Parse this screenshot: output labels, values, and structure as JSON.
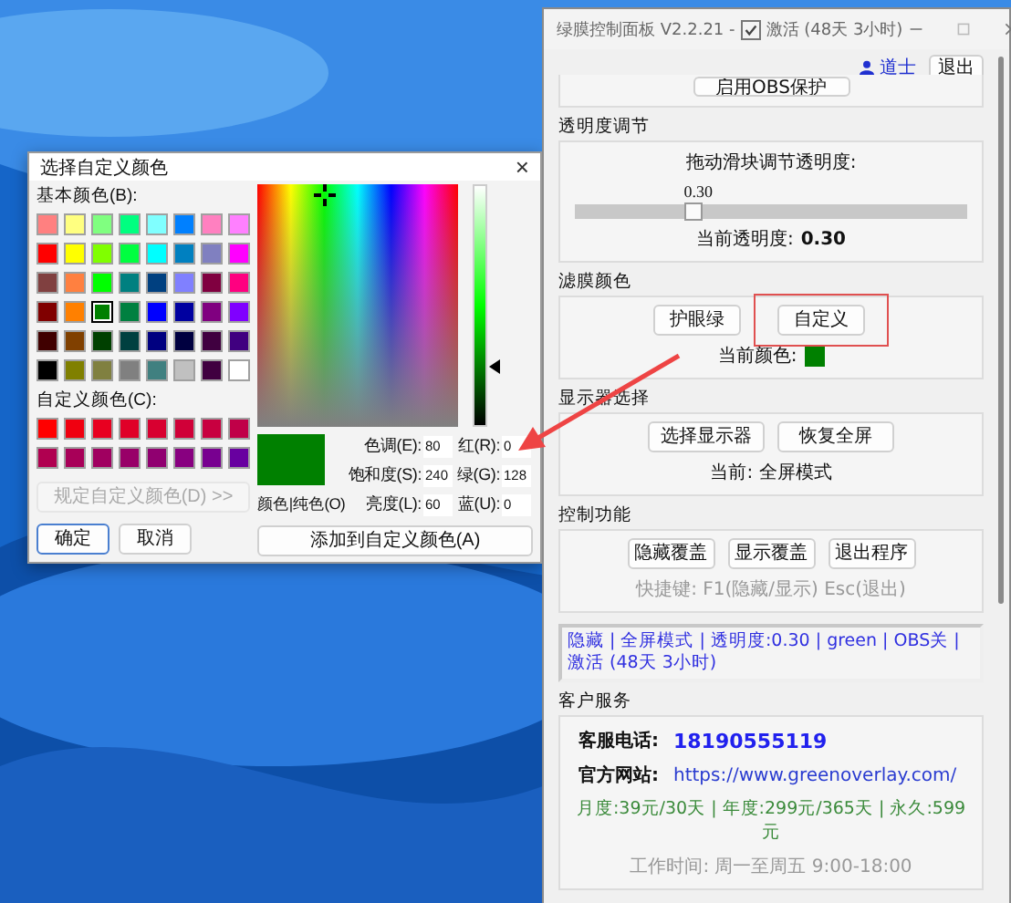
{
  "color_dialog": {
    "title": "选择自定义颜色",
    "close": "×",
    "basic_label": "基本颜色(B):",
    "basic_colors": [
      {
        "color": "#ff8080",
        "selected": false
      },
      {
        "color": "#ffff80",
        "selected": false
      },
      {
        "color": "#80ff80",
        "selected": false
      },
      {
        "color": "#00ff80",
        "selected": false
      },
      {
        "color": "#80ffff",
        "selected": false
      },
      {
        "color": "#0080ff",
        "selected": false
      },
      {
        "color": "#ff80c0",
        "selected": false
      },
      {
        "color": "#ff80ff",
        "selected": false
      },
      {
        "color": "#ff0000",
        "selected": false
      },
      {
        "color": "#ffff00",
        "selected": false
      },
      {
        "color": "#80ff00",
        "selected": false
      },
      {
        "color": "#00ff40",
        "selected": false
      },
      {
        "color": "#00ffff",
        "selected": false
      },
      {
        "color": "#0080c0",
        "selected": false
      },
      {
        "color": "#8080c0",
        "selected": false
      },
      {
        "color": "#ff00ff",
        "selected": false
      },
      {
        "color": "#804040",
        "selected": false
      },
      {
        "color": "#ff8040",
        "selected": false
      },
      {
        "color": "#00ff00",
        "selected": false
      },
      {
        "color": "#008080",
        "selected": false
      },
      {
        "color": "#004080",
        "selected": false
      },
      {
        "color": "#8080ff",
        "selected": false
      },
      {
        "color": "#800040",
        "selected": false
      },
      {
        "color": "#ff0080",
        "selected": false
      },
      {
        "color": "#800000",
        "selected": false
      },
      {
        "color": "#ff8000",
        "selected": false
      },
      {
        "color": "#008000",
        "selected": true
      },
      {
        "color": "#008040",
        "selected": false
      },
      {
        "color": "#0000ff",
        "selected": false
      },
      {
        "color": "#0000a0",
        "selected": false
      },
      {
        "color": "#800080",
        "selected": false
      },
      {
        "color": "#8000ff",
        "selected": false
      },
      {
        "color": "#400000",
        "selected": false
      },
      {
        "color": "#804000",
        "selected": false
      },
      {
        "color": "#004000",
        "selected": false
      },
      {
        "color": "#004040",
        "selected": false
      },
      {
        "color": "#000080",
        "selected": false
      },
      {
        "color": "#000040",
        "selected": false
      },
      {
        "color": "#400040",
        "selected": false
      },
      {
        "color": "#400080",
        "selected": false
      },
      {
        "color": "#000000",
        "selected": false
      },
      {
        "color": "#808000",
        "selected": false
      },
      {
        "color": "#808040",
        "selected": false
      },
      {
        "color": "#808080",
        "selected": false
      },
      {
        "color": "#408080",
        "selected": false
      },
      {
        "color": "#c0c0c0",
        "selected": false
      },
      {
        "color": "#400040",
        "selected": false
      },
      {
        "color": "#ffffff",
        "selected": false
      }
    ],
    "custom_label": "自定义颜色(C):",
    "custom_colors": [
      {
        "color": "#ff0000"
      },
      {
        "color": "#f00010"
      },
      {
        "color": "#e80020"
      },
      {
        "color": "#e00028"
      },
      {
        "color": "#d80030"
      },
      {
        "color": "#d00038"
      },
      {
        "color": "#c80040"
      },
      {
        "color": "#c00048"
      },
      {
        "color": "#b00050"
      },
      {
        "color": "#a80058"
      },
      {
        "color": "#a00060"
      },
      {
        "color": "#980068"
      },
      {
        "color": "#900070"
      },
      {
        "color": "#880080"
      },
      {
        "color": "#780090"
      },
      {
        "color": "#6800a0"
      }
    ],
    "define_button": {
      "label": "规定自定义颜色(D) >>",
      "disabled": true
    },
    "ok_button": "确定",
    "cancel_button": "取消",
    "solid_label": "颜色|纯色(O)",
    "fields": [
      {
        "label": "色调(E):",
        "value": "80"
      },
      {
        "label": "红(R):",
        "value": "0"
      },
      {
        "label": "饱和度(S):",
        "value": "240"
      },
      {
        "label": "绿(G):",
        "value": "128"
      },
      {
        "label": "亮度(L):",
        "value": "60"
      },
      {
        "label": "蓝(U):",
        "value": "0"
      }
    ],
    "add_button": "添加到自定义颜色(A)"
  },
  "main_window": {
    "title": "绿膜控制面板 V2.2.21 -",
    "activation": {
      "checked": true,
      "label": "激活 (48天 3小时)"
    },
    "user": "道士",
    "logout_button": "退出",
    "top_button": "启用OBS保护",
    "opacity": {
      "title": "透明度调节",
      "prompt": "拖动滑块调节透明度:",
      "slider_value": "0.30",
      "level": 0.3,
      "current_label": "当前透明度:",
      "current_value": "0.30"
    },
    "filter_color": {
      "title": "滤膜颜色",
      "buttons": [
        {
          "label": "护眼绿",
          "highlighted": false
        },
        {
          "label": "自定义",
          "highlighted": true
        }
      ],
      "current_label": "当前颜色:"
    },
    "display": {
      "title": "显示器选择",
      "buttons": [
        "选择显示器",
        "恢复全屏"
      ],
      "status": "当前: 全屏模式"
    },
    "controls": {
      "title": "控制功能",
      "buttons": [
        "隐藏覆盖",
        "显示覆盖",
        "退出程序"
      ],
      "hotkeys": "快捷键: F1(隐藏/显示)  Esc(退出)"
    },
    "status_bar": "隐藏 | 全屏模式 | 透明度:0.30 | green | OBS关 | 激活 (48天 3小时)",
    "service": {
      "title": "客户服务",
      "phone_label": "客服电话:",
      "phone": "18190555119",
      "site_label": "官方网站:",
      "site": "https://www.greenoverlay.com/",
      "pricing": "月度:39元/30天 | 年度:299元/365天 | 永久:599元",
      "hours": "工作时间: 周一至周五 9:00-18:00"
    }
  }
}
